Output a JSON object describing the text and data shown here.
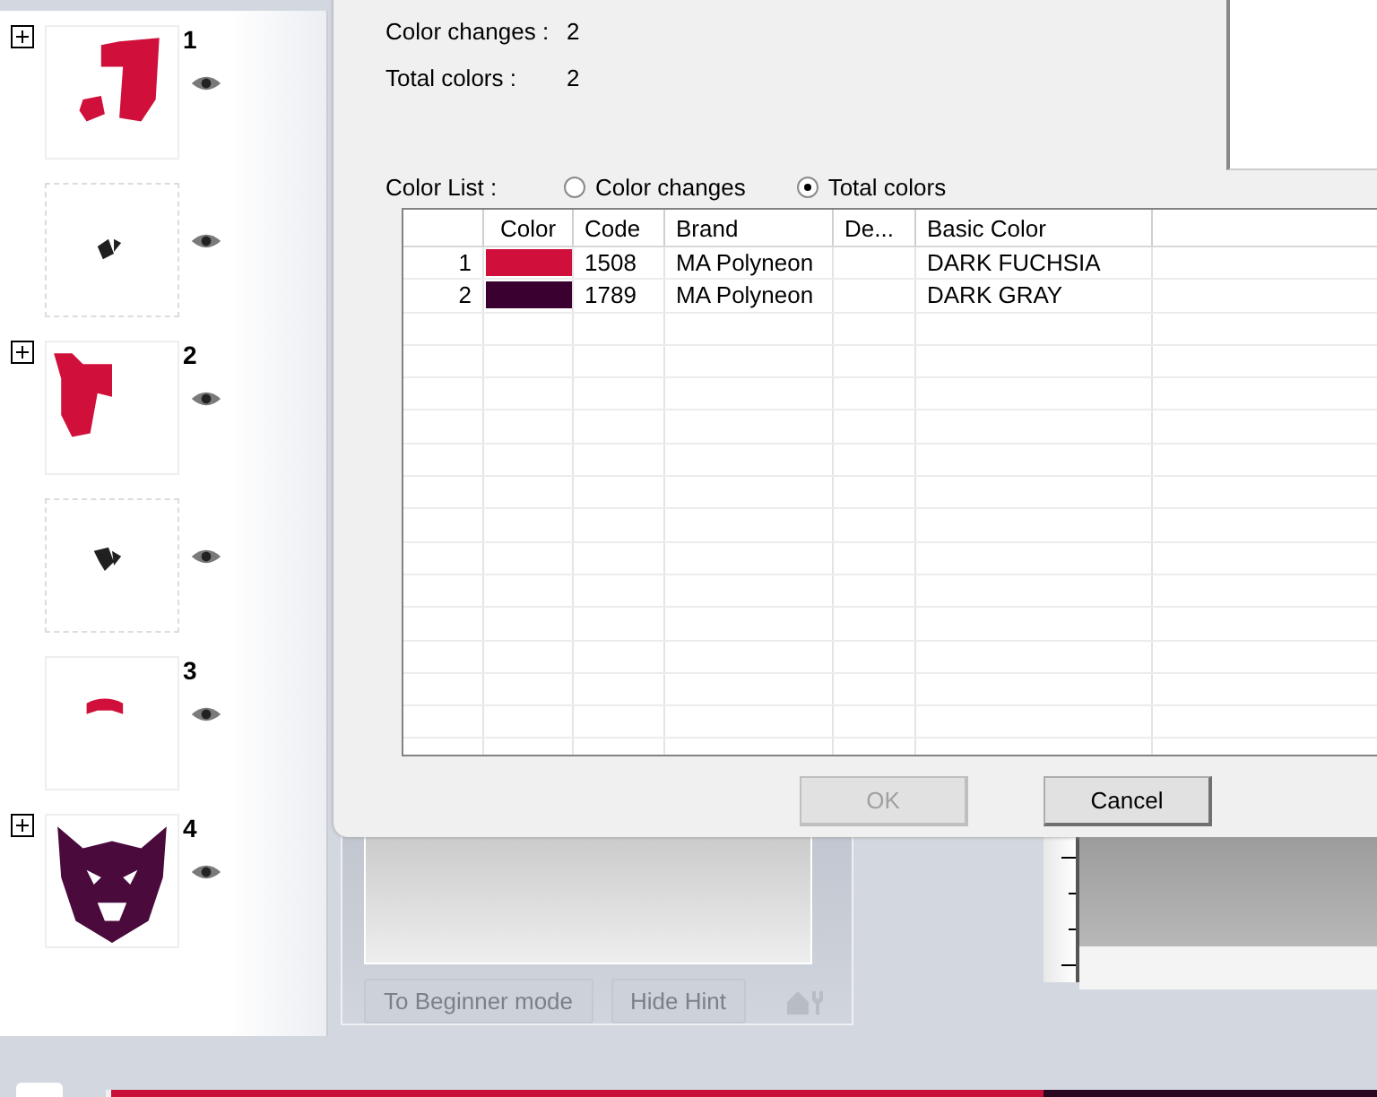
{
  "layers": [
    {
      "kind": "layer",
      "number": "1",
      "expandable": true,
      "expanded": false,
      "visible": true,
      "color": "#d0103a"
    },
    {
      "kind": "sub",
      "visible": true,
      "color": "#202020"
    },
    {
      "kind": "layer",
      "number": "2",
      "expandable": true,
      "expanded": false,
      "visible": true,
      "color": "#d0103a"
    },
    {
      "kind": "sub",
      "visible": true,
      "color": "#202020"
    },
    {
      "kind": "layer",
      "number": "3",
      "expandable": false,
      "visible": true,
      "color": "#d0103a"
    },
    {
      "kind": "layer",
      "number": "4",
      "expandable": true,
      "expanded": false,
      "visible": true,
      "color": "#4a0a3c"
    }
  ],
  "dialog": {
    "stats": [
      {
        "label": "Color changes :",
        "value": "2"
      },
      {
        "label": "Total colors :",
        "value": "2"
      }
    ],
    "color_list": {
      "label": "Color List :",
      "options": [
        {
          "label": "Color changes",
          "selected": false
        },
        {
          "label": "Total colors",
          "selected": true
        }
      ]
    },
    "table": {
      "columns": [
        "Color",
        "Code",
        "Brand",
        "De...",
        "Basic Color"
      ],
      "rows": [
        {
          "index": "1",
          "color": "#d0103a",
          "code": "1508",
          "brand": "MA Polyneon",
          "basic_color": "DARK FUCHSIA"
        },
        {
          "index": "2",
          "color": "#3a0030",
          "code": "1789",
          "brand": "MA Polyneon",
          "basic_color": "DARK GRAY"
        }
      ]
    },
    "buttons": [
      {
        "label": "OK",
        "disabled": true
      },
      {
        "label": "Cancel",
        "disabled": false
      }
    ]
  },
  "hint_panel": {
    "buttons": [
      {
        "label": "To Beginner mode",
        "disabled": true
      },
      {
        "label": "Hide Hint",
        "disabled": true
      }
    ]
  }
}
